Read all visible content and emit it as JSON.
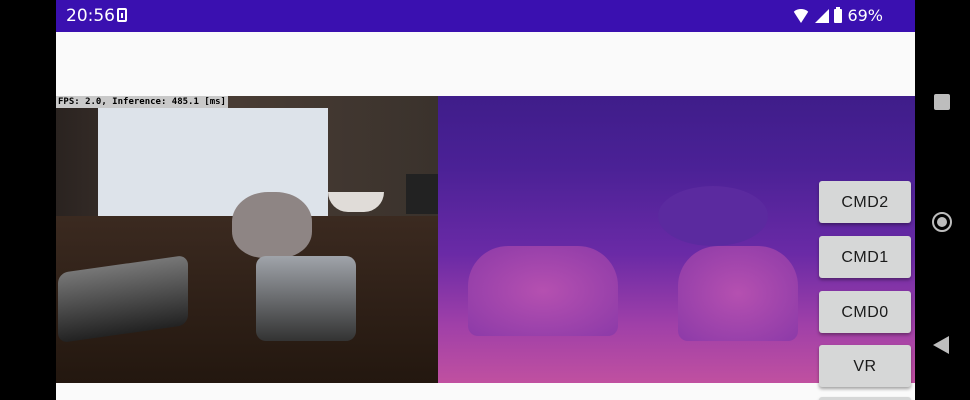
{
  "status_bar": {
    "time": "20:56",
    "battery": "69%",
    "background_color": "#3a10b0"
  },
  "camera_view": {
    "overlay_text": "FPS: 2.0, Inference: 485.1 [ms]"
  },
  "controls": {
    "buttons": [
      {
        "label": "CMD2"
      },
      {
        "label": "CMD1"
      },
      {
        "label": "CMD0"
      },
      {
        "label": "VR"
      }
    ]
  },
  "icons": {
    "status": [
      "download-icon",
      "wifi-icon",
      "signal-icon",
      "battery-icon"
    ],
    "nav": [
      "recents-icon",
      "home-icon",
      "back-icon"
    ]
  }
}
